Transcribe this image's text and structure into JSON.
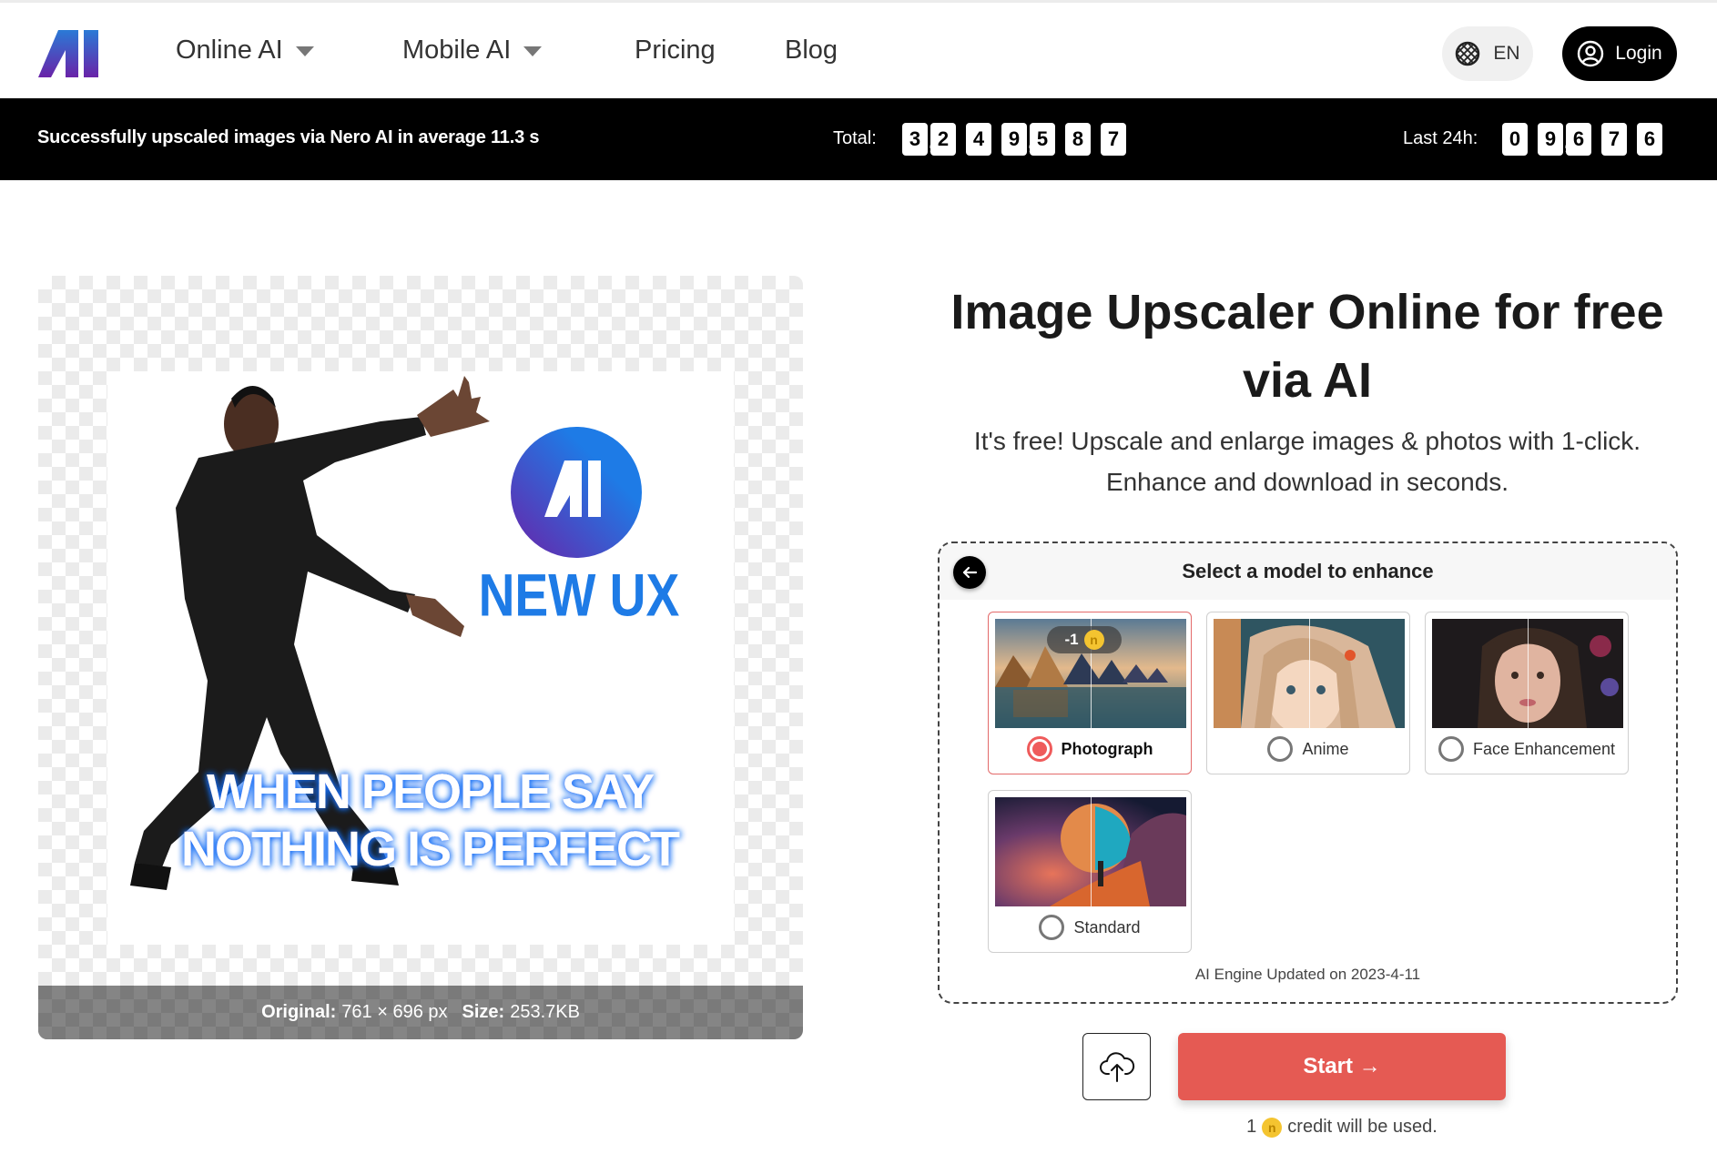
{
  "header": {
    "logo_alt": "AI",
    "nav": [
      {
        "label": "Online AI",
        "has_dropdown": true
      },
      {
        "label": "Mobile AI",
        "has_dropdown": true
      },
      {
        "label": "Pricing",
        "has_dropdown": false
      },
      {
        "label": "Blog",
        "has_dropdown": false
      }
    ],
    "language": {
      "icon": "globe-icon",
      "label": "EN"
    },
    "login": {
      "icon": "user-circle-icon",
      "label": "Login"
    }
  },
  "stats": {
    "message": "Successfully upscaled images via Nero AI in average 11.3 s",
    "total_label": "Total:",
    "total_value": "3,249,587",
    "total_digits": [
      "3",
      ",",
      "2",
      "4",
      "9",
      ",",
      "5",
      "8",
      "7"
    ],
    "last24_label": "Last 24h:",
    "last24_value": "09,676",
    "last24_digits": [
      "0",
      "9",
      ",",
      "6",
      "7",
      "6"
    ]
  },
  "preview": {
    "meme_top_text": "NEW UX",
    "meme_logo_text": "AI",
    "meme_bottom_line1": "WHEN PEOPLE SAY",
    "meme_bottom_line2": "NOTHING IS PERFECT",
    "caption": {
      "original_label": "Original:",
      "original_value": "761 × 696 px",
      "size_label": "Size:",
      "size_value": "253.7KB"
    }
  },
  "hero": {
    "title_line1": "Image Upscaler Online for free",
    "title_line2": "via AI",
    "subtitle_line1": "It's free! Upscale and enlarge images & photos with 1-click.",
    "subtitle_line2": "Enhance and download in seconds."
  },
  "models": {
    "header": "Select a model to enhance",
    "back_icon": "arrow-left-icon",
    "items": [
      {
        "label": "Photograph",
        "selected": true,
        "cost_badge": "-1"
      },
      {
        "label": "Anime",
        "selected": false
      },
      {
        "label": "Face Enhancement",
        "selected": false
      },
      {
        "label": "Standard",
        "selected": false
      }
    ],
    "engine_note": "AI Engine Updated on 2023-4-11"
  },
  "actions": {
    "upload_icon": "cloud-upload-icon",
    "start_label": "Start →",
    "credit_count": "1",
    "credit_coin": "n",
    "credit_text": "credit will be used."
  },
  "colors": {
    "accent": "#e55a53",
    "selected_radio": "#ef5b5b",
    "stats_bar": "#000000",
    "coin": "#f4c430",
    "brand_blue": "#1e7be6",
    "brand_purple": "#6a23a8"
  }
}
